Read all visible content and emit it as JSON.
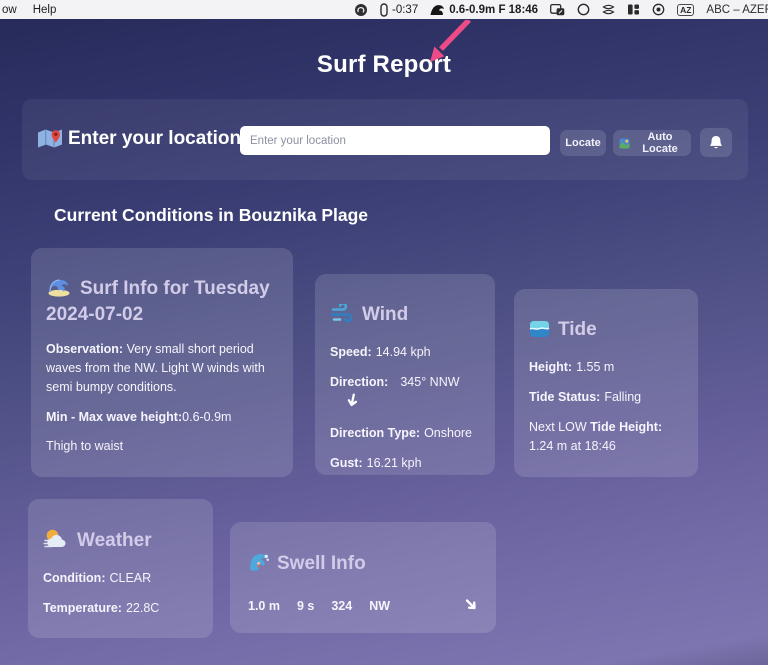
{
  "menu_bar": {
    "menu_fragment": "ow",
    "menu_help": "Help",
    "timer_text": "-0:37",
    "surf_status": "0.6-0.9m F 18:46",
    "input_source_badge": "AZ",
    "keyboard_label": "ABC – AZER"
  },
  "page": {
    "title": "Surf Report",
    "location": {
      "heading": "Enter your location",
      "placeholder": "Enter your location",
      "locate": "Locate",
      "auto_locate": "Auto Locate"
    },
    "section_heading": "Current Conditions in Bouznika Plage",
    "surf_card": {
      "title_line1": "Surf Info for Tuesday",
      "title_line2": "2024-07-02",
      "observation_label": "Observation:",
      "observation_text": " Very small short period waves from the NW. Light W winds with semi bumpy conditions.",
      "range_label": "Min - Max wave height:",
      "range_value": "0.6-0.9m",
      "note": "Thigh to waist"
    },
    "wind_card": {
      "title": "Wind",
      "speed_label": "Speed:",
      "speed_value": "14.94 kph",
      "direction_label": "Direction:",
      "direction_value": "345° NNW",
      "direction_type_label": "Direction Type:",
      "direction_type_value": "Onshore",
      "gust_label": "Gust:",
      "gust_value": "16.21 kph"
    },
    "tide_card": {
      "title": "Tide",
      "height_label": "Height:",
      "height_value": "1.55 m",
      "status_label": "Tide Status:",
      "status_value": "Falling",
      "next_prefix": "Next LOW",
      "next_label": " Tide Height:",
      "next_value": "1.24 m at 18:46"
    },
    "weather_card": {
      "title": "Weather",
      "condition_label": "Condition:",
      "condition_value": "CLEAR",
      "temperature_label": "Temperature:",
      "temperature_value": "22.8C"
    },
    "swell_card": {
      "title": "Swell Info",
      "height": "1.0 m",
      "period": "9 s",
      "bearing": "324",
      "compass": "NW"
    }
  },
  "colors": {
    "annotation_arrow": "#ec4b88",
    "background_top": "#2a2e60",
    "background_bottom": "#7c74af",
    "card_tint": "rgba(255,255,255,0.135)",
    "menubar_bg": "#f3f2f4",
    "card_title_text": "#d2cce9"
  }
}
